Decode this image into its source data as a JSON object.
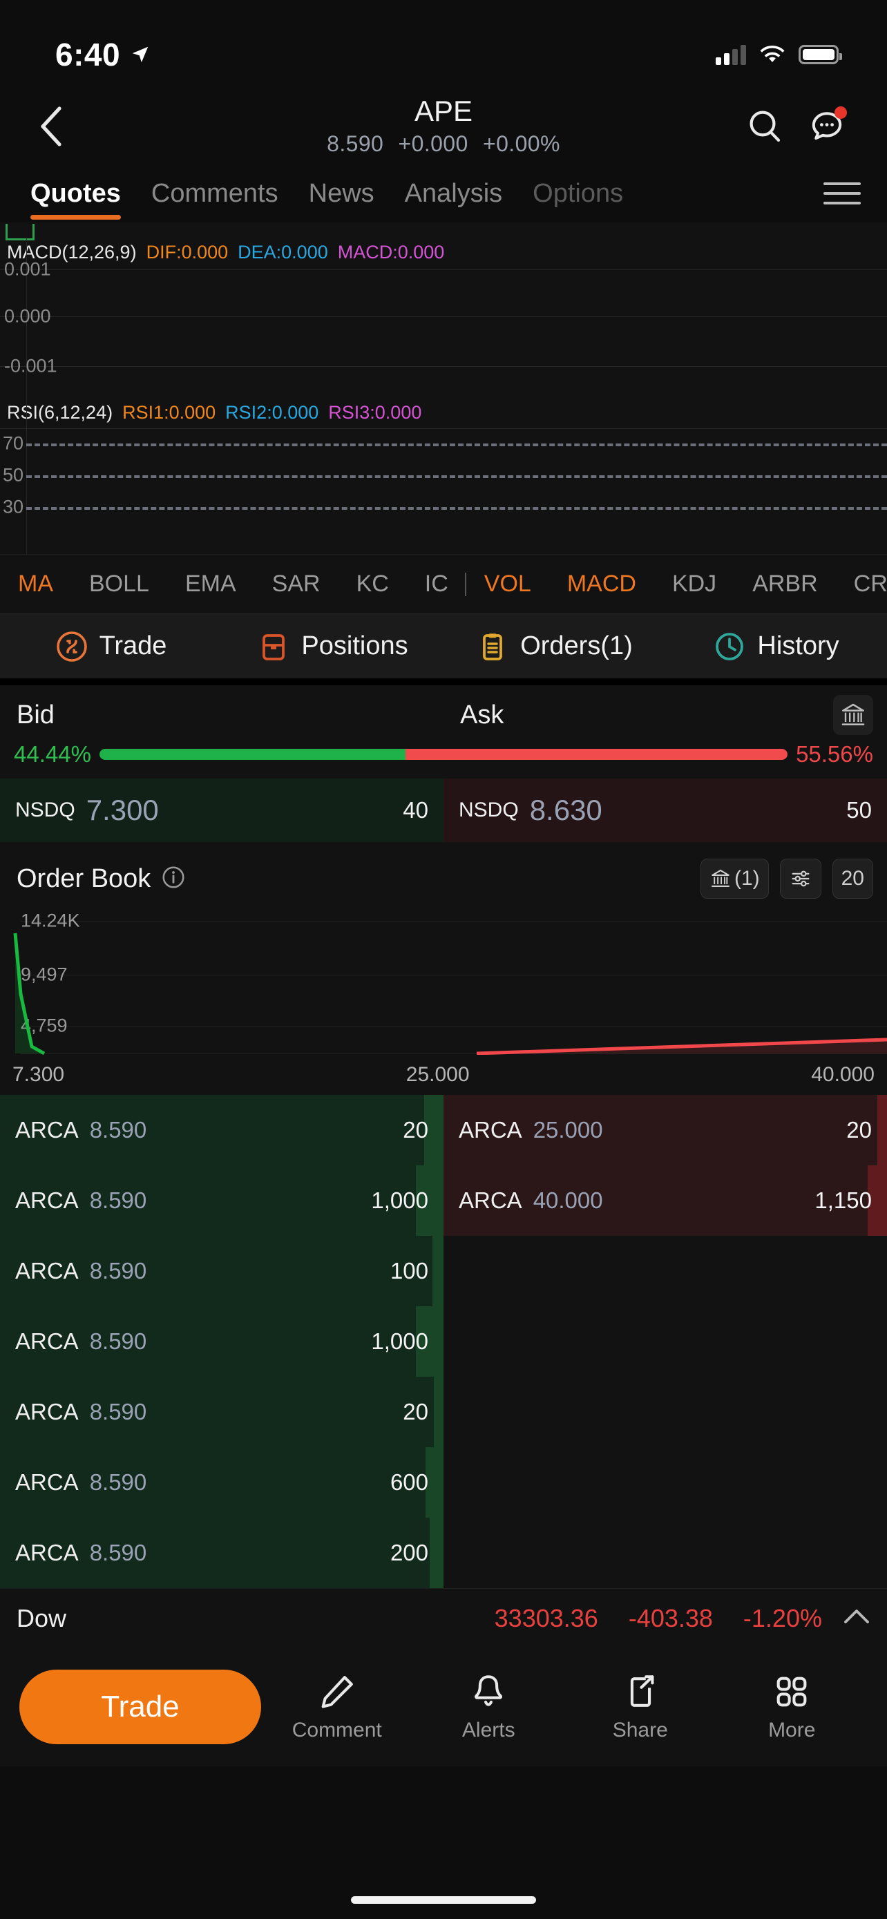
{
  "status_bar": {
    "time": "6:40",
    "location_icon": "location-arrow-icon",
    "signal_icon": "cellular-bars-icon",
    "wifi_icon": "wifi-icon",
    "battery_icon": "battery-icon"
  },
  "header": {
    "back_icon": "chevron-left-icon",
    "title": "APE",
    "price": "8.590",
    "change": "+0.000",
    "change_percent": "+0.00%",
    "search_icon": "search-icon",
    "more_icon": "more-chat-icon",
    "notification_dot": true
  },
  "tabs": {
    "items": [
      {
        "label": "Quotes",
        "active": true
      },
      {
        "label": "Comments",
        "active": false
      },
      {
        "label": "News",
        "active": false
      },
      {
        "label": "Analysis",
        "active": false
      },
      {
        "label": "Options",
        "active": false
      }
    ],
    "menu_icon": "hamburger-menu-icon",
    "accent": "#e86c21"
  },
  "chart": {
    "macd": {
      "name": "MACD(12,26,9)",
      "dif": "DIF:0.000",
      "dea": "DEA:0.000",
      "macd": "MACD:0.000",
      "axis": [
        "0.001",
        "0.000",
        "-0.001"
      ],
      "colors": {
        "dif": "#f0861e",
        "dea": "#29a7e0",
        "macd": "#d454d4"
      }
    },
    "rsi": {
      "name": "RSI(6,12,24)",
      "rsi1": "RSI1:0.000",
      "rsi2": "RSI2:0.000",
      "rsi3": "RSI3:0.000",
      "axis": [
        "70",
        "50",
        "30"
      ],
      "colors": {
        "rsi1": "#f0861e",
        "rsi2": "#29a7e0",
        "rsi3": "#d454d4"
      }
    }
  },
  "indicators": {
    "items": [
      {
        "label": "MA",
        "active": true
      },
      {
        "label": "BOLL",
        "active": false
      },
      {
        "label": "EMA",
        "active": false
      },
      {
        "label": "SAR",
        "active": false
      },
      {
        "label": "KC",
        "active": false
      },
      {
        "label": "IC",
        "active": false
      },
      {
        "label": "VOL",
        "active": true
      },
      {
        "label": "MACD",
        "active": true
      },
      {
        "label": "KDJ",
        "active": false
      },
      {
        "label": "ARBR",
        "active": false
      },
      {
        "label": "CR",
        "active": false
      }
    ],
    "active_color": "#ef7722"
  },
  "action_row": {
    "items": [
      {
        "label": "Trade",
        "icon": "trade-circle-icon",
        "color": "#e8763a"
      },
      {
        "label": "Positions",
        "icon": "positions-box-icon",
        "color": "#d9552a"
      },
      {
        "label": "Orders(1)",
        "icon": "orders-clipboard-icon",
        "color": "#e0a82e"
      },
      {
        "label": "History",
        "icon": "history-clock-icon",
        "color": "#2fa89b"
      }
    ]
  },
  "bid_ask": {
    "bid_label": "Bid",
    "ask_label": "Ask",
    "bank_icon": "exchange-bank-icon",
    "bid_percent": "44.44%",
    "ask_percent": "55.56%",
    "bid_ratio": 44.44,
    "ask_ratio": 55.56,
    "bid_color": "#2fbe4f",
    "ask_color": "#f0474b",
    "best_bid": {
      "market": "NSDQ",
      "price": "7.300",
      "size": "40"
    },
    "best_ask": {
      "market": "NSDQ",
      "price": "8.630",
      "size": "50"
    }
  },
  "order_book": {
    "title": "Order Book",
    "info_icon": "info-circle-icon",
    "chips": [
      {
        "label": "(1)",
        "icon": "exchange-bank-icon"
      },
      {
        "label": "",
        "icon": "filter-sliders-icon"
      },
      {
        "label": "20",
        "icon": ""
      }
    ],
    "depth": {
      "y_labels": [
        "14.24K",
        "9,497",
        "4,759"
      ],
      "x_labels": [
        "7.300",
        "25.000",
        "40.000"
      ],
      "bid_color": "#18b93f",
      "ask_color": "#f2474b"
    },
    "bids": [
      {
        "market": "ARCA",
        "price": "8.590",
        "size": "20",
        "fill": 3
      },
      {
        "market": "ARCA",
        "price": "8.590",
        "size": "1,000",
        "fill": 6
      },
      {
        "market": "ARCA",
        "price": "8.590",
        "size": "100",
        "fill": 2
      },
      {
        "market": "ARCA",
        "price": "8.590",
        "size": "1,000",
        "fill": 6
      },
      {
        "market": "ARCA",
        "price": "8.590",
        "size": "20",
        "fill": 2
      },
      {
        "market": "ARCA",
        "price": "8.590",
        "size": "600",
        "fill": 4
      },
      {
        "market": "ARCA",
        "price": "8.590",
        "size": "200",
        "fill": 3
      }
    ],
    "asks": [
      {
        "market": "ARCA",
        "price": "25.000",
        "size": "20",
        "fill": 2
      },
      {
        "market": "ARCA",
        "price": "40.000",
        "size": "1,150",
        "fill": 4
      }
    ]
  },
  "index_ticker": {
    "name": "Dow",
    "value": "33303.36",
    "change": "-403.38",
    "change_percent": "-1.20%",
    "color": "#e8413f",
    "expand_icon": "chevron-up-icon"
  },
  "bottom_bar": {
    "trade_label": "Trade",
    "trade_color": "#f07712",
    "items": [
      {
        "label": "Comment",
        "icon": "pencil-icon"
      },
      {
        "label": "Alerts",
        "icon": "bell-icon"
      },
      {
        "label": "Share",
        "icon": "share-icon"
      },
      {
        "label": "More",
        "icon": "grid-more-icon"
      }
    ]
  }
}
